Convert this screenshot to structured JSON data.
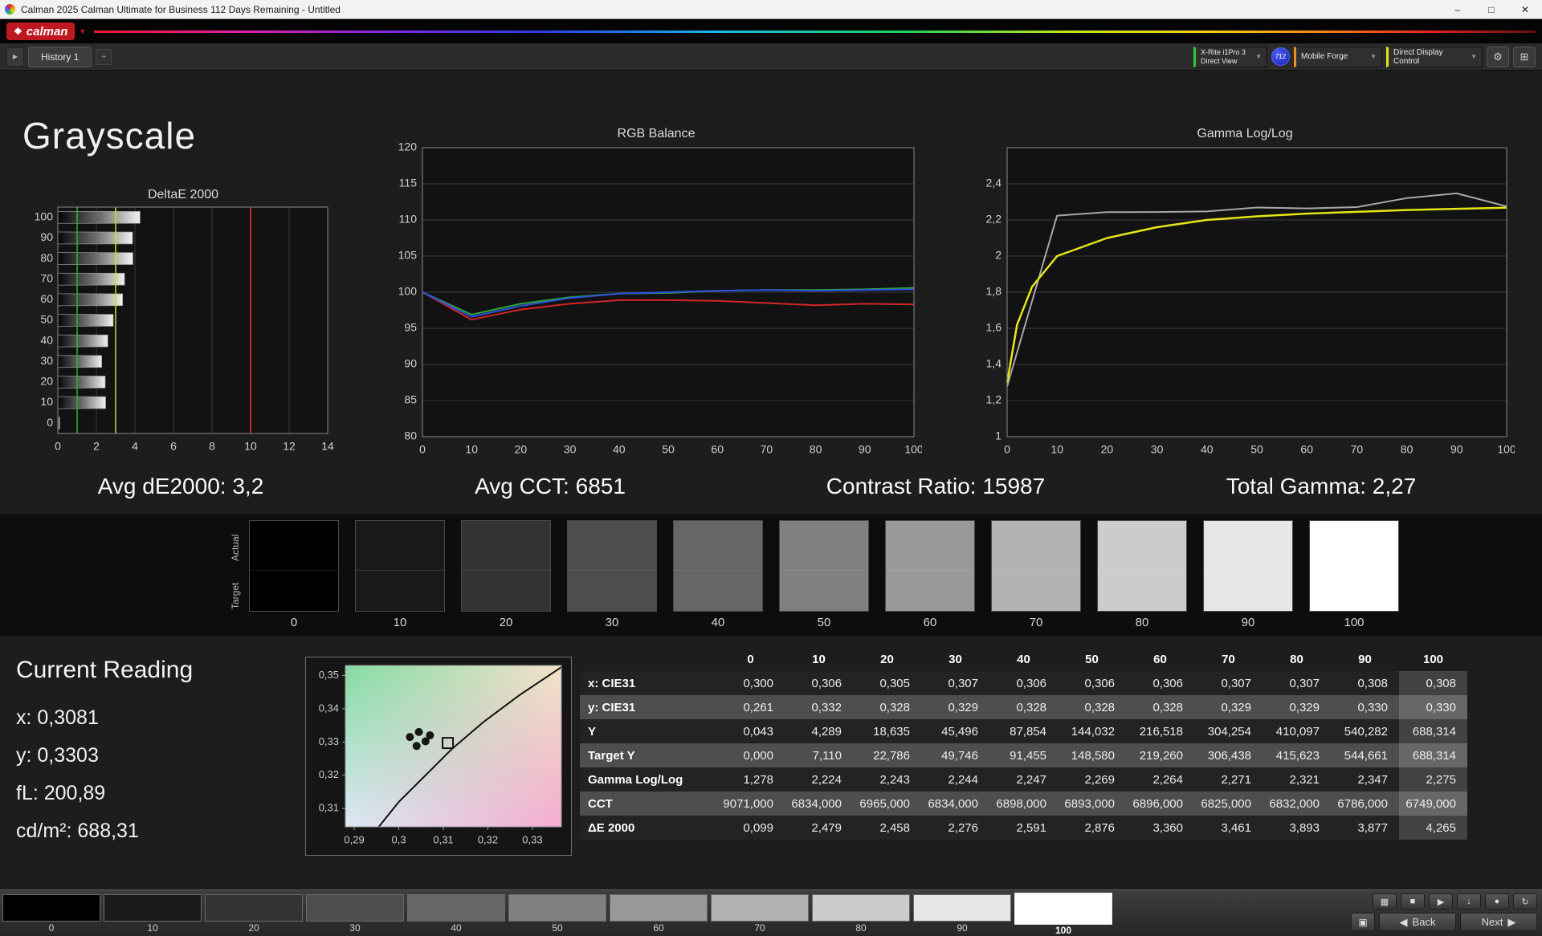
{
  "window": {
    "title": "Calman 2025 Calman Ultimate for Business 112 Days Remaining  - Untitled",
    "minimize_glyph": "–",
    "maximize_glyph": "□",
    "close_glyph": "✕"
  },
  "brand": {
    "logo_text": "calman",
    "logo_mark_glyph": "❖",
    "caret_glyph": "▼"
  },
  "toolbar": {
    "history_toggle_glyph": "▶",
    "history_tab": "History 1",
    "add_glyph": "+",
    "meter_line1": "X-Rite i1Pro 3",
    "meter_line2": "Direct View",
    "meter_badge": "712",
    "source": "Mobile Forge",
    "display_control": "Direct Display Control",
    "caret_glyph": "▼",
    "gear_glyph": "⚙",
    "layout_glyph": "⊞"
  },
  "page": {
    "title": "Grayscale"
  },
  "stats": {
    "avg_de": "Avg dE2000: 3,2",
    "avg_cct": "Avg CCT: 6851",
    "contrast": "Contrast Ratio: 15987",
    "total_gamma": "Total Gamma: 2,27"
  },
  "charts": {
    "deltae": {
      "type": "bar",
      "title": "DeltaE 2000",
      "categories": [
        100,
        90,
        80,
        70,
        60,
        50,
        40,
        30,
        20,
        10,
        0
      ],
      "values": [
        4.265,
        3.877,
        3.893,
        3.461,
        3.36,
        2.876,
        2.591,
        2.276,
        2.458,
        2.479,
        0.099
      ],
      "xlim": [
        0,
        14
      ],
      "xticks": [
        0,
        2,
        4,
        6,
        8,
        10,
        12,
        14
      ],
      "ref_lines": [
        {
          "x": 1,
          "color": "#2db32d"
        },
        {
          "x": 3,
          "color": "#d8d81a"
        },
        {
          "x": 10,
          "color": "#c22222"
        }
      ]
    },
    "rgb_balance": {
      "type": "line",
      "title": "RGB Balance",
      "x": [
        0,
        10,
        20,
        30,
        40,
        50,
        60,
        70,
        80,
        90,
        100
      ],
      "xlim": [
        0,
        100
      ],
      "xticks": [
        0,
        10,
        20,
        30,
        40,
        50,
        60,
        70,
        80,
        90,
        100
      ],
      "ylim": [
        80,
        120
      ],
      "yticks": [
        80,
        85,
        90,
        95,
        100,
        105,
        110,
        115,
        120
      ],
      "ytick_labels": [
        "80",
        "85",
        "90",
        "95",
        "100",
        "105",
        "110",
        "115",
        "120"
      ],
      "series": [
        {
          "name": "Red",
          "color": "#d42525",
          "width": 2,
          "values": [
            100,
            96.2,
            97.6,
            98.4,
            98.9,
            98.9,
            98.8,
            98.5,
            98.2,
            98.4,
            98.3
          ]
        },
        {
          "name": "Green",
          "color": "#2aa83a",
          "width": 2,
          "values": [
            100,
            96.9,
            98.4,
            99.3,
            99.8,
            99.9,
            100.2,
            100.3,
            100.3,
            100.4,
            100.6
          ]
        },
        {
          "name": "Blue",
          "color": "#2f4fe0",
          "width": 2,
          "values": [
            100,
            96.6,
            98.1,
            99.2,
            99.8,
            100,
            100.2,
            100.3,
            100.2,
            100.3,
            100.4
          ]
        }
      ]
    },
    "gamma": {
      "type": "line",
      "title": "Gamma Log/Log",
      "x": [
        0,
        10,
        20,
        30,
        40,
        50,
        60,
        70,
        80,
        90,
        100
      ],
      "xlim": [
        0,
        100
      ],
      "xticks": [
        0,
        10,
        20,
        30,
        40,
        50,
        60,
        70,
        80,
        90,
        100
      ],
      "ylim": [
        1,
        2.6
      ],
      "yticks": [
        1,
        1.2,
        1.4,
        1.6,
        1.8,
        2,
        2.2,
        2.4
      ],
      "ytick_labels": [
        "1",
        "1,2",
        "1,4",
        "1,6",
        "1,8",
        "2",
        "2,2",
        "2,4"
      ],
      "series": [
        {
          "name": "Measured",
          "color": "#a8a8a8",
          "width": 2,
          "values": [
            1.278,
            2.224,
            2.243,
            2.244,
            2.247,
            2.269,
            2.264,
            2.271,
            2.321,
            2.347,
            2.275
          ]
        },
        {
          "name": "Target",
          "color": "#e6e616",
          "width": 2.5,
          "x": [
            0,
            2,
            5,
            10,
            20,
            30,
            40,
            50,
            60,
            70,
            80,
            90,
            100
          ],
          "values": [
            1.3,
            1.62,
            1.83,
            2.0,
            2.1,
            2.16,
            2.2,
            2.22,
            2.235,
            2.245,
            2.255,
            2.262,
            2.268
          ]
        }
      ]
    }
  },
  "swatches": {
    "actual_label": "Actual",
    "target_label": "Target",
    "levels": [
      0,
      10,
      20,
      30,
      40,
      50,
      60,
      70,
      80,
      90,
      100
    ]
  },
  "reading": {
    "title": "Current Reading",
    "items": [
      {
        "label": "x:",
        "value": "0,3081"
      },
      {
        "label": "y:",
        "value": "0,3303"
      },
      {
        "label": "fL:",
        "value": "200,89"
      },
      {
        "label": "cd/m²:",
        "value": "688,31"
      }
    ]
  },
  "cie": {
    "xlim": [
      0.288,
      0.3365
    ],
    "ylim": [
      0.3045,
      0.353
    ],
    "x_ticks": [
      {
        "v": 0.29,
        "label": "0,29"
      },
      {
        "v": 0.3,
        "label": "0,3"
      },
      {
        "v": 0.31,
        "label": "0,31"
      },
      {
        "v": 0.32,
        "label": "0,32"
      },
      {
        "v": 0.33,
        "label": "0,33"
      }
    ],
    "y_ticks": [
      {
        "v": 0.35,
        "label": "0,35"
      },
      {
        "v": 0.34,
        "label": "0,34"
      },
      {
        "v": 0.33,
        "label": "0,33"
      },
      {
        "v": 0.32,
        "label": "0,32"
      },
      {
        "v": 0.31,
        "label": "0,31"
      }
    ],
    "locus": [
      [
        0.2955,
        0.3045
      ],
      [
        0.3,
        0.312
      ],
      [
        0.306,
        0.32
      ],
      [
        0.312,
        0.328
      ],
      [
        0.319,
        0.336
      ],
      [
        0.327,
        0.344
      ],
      [
        0.3365,
        0.3525
      ]
    ],
    "points": [
      [
        0.3025,
        0.3315
      ],
      [
        0.3045,
        0.333
      ],
      [
        0.306,
        0.3302
      ],
      [
        0.304,
        0.3288
      ],
      [
        0.307,
        0.332
      ]
    ],
    "target_marker": [
      0.311,
      0.3297
    ]
  },
  "table": {
    "columns": [
      "0",
      "10",
      "20",
      "30",
      "40",
      "50",
      "60",
      "70",
      "80",
      "90",
      "100"
    ],
    "highlight_column_index": 10,
    "rows": [
      {
        "label": "x: CIE31",
        "values": [
          "0,300",
          "0,306",
          "0,305",
          "0,307",
          "0,306",
          "0,306",
          "0,306",
          "0,307",
          "0,307",
          "0,308",
          "0,308"
        ]
      },
      {
        "label": "y: CIE31",
        "values": [
          "0,261",
          "0,332",
          "0,328",
          "0,329",
          "0,328",
          "0,328",
          "0,328",
          "0,329",
          "0,329",
          "0,330",
          "0,330"
        ]
      },
      {
        "label": "Y",
        "values": [
          "0,043",
          "4,289",
          "18,635",
          "45,496",
          "87,854",
          "144,032",
          "216,518",
          "304,254",
          "410,097",
          "540,282",
          "688,314"
        ]
      },
      {
        "label": "Target Y",
        "values": [
          "0,000",
          "7,110",
          "22,786",
          "49,746",
          "91,455",
          "148,580",
          "219,260",
          "306,438",
          "415,623",
          "544,661",
          "688,314"
        ]
      },
      {
        "label": "Gamma Log/Log",
        "values": [
          "1,278",
          "2,224",
          "2,243",
          "2,244",
          "2,247",
          "2,269",
          "2,264",
          "2,271",
          "2,321",
          "2,347",
          "2,275"
        ]
      },
      {
        "label": "CCT",
        "values": [
          "9071,000",
          "6834,000",
          "6965,000",
          "6834,000",
          "6898,000",
          "6893,000",
          "6896,000",
          "6825,000",
          "6832,000",
          "6786,000",
          "6749,000"
        ]
      },
      {
        "label": "ΔE 2000",
        "values": [
          "0,099",
          "2,479",
          "2,458",
          "2,276",
          "2,591",
          "2,876",
          "3,360",
          "3,461",
          "3,893",
          "3,877",
          "4,265"
        ]
      }
    ]
  },
  "bottom": {
    "levels": [
      0,
      10,
      20,
      30,
      40,
      50,
      60,
      70,
      80,
      90,
      100
    ],
    "selected": 100,
    "back_label": "Back",
    "next_label": "Next",
    "back_icon": "◀",
    "next_icon": "▶",
    "grid_button_glyph": "▣",
    "transport_buttons": [
      {
        "name": "pattern-window-button",
        "glyph": "▦"
      },
      {
        "name": "stop-button",
        "glyph": "■"
      },
      {
        "name": "play-button",
        "glyph": "▶"
      },
      {
        "name": "save-button",
        "glyph": "↓"
      },
      {
        "name": "record-button",
        "glyph": "●"
      },
      {
        "name": "refresh-button",
        "glyph": "↻"
      }
    ]
  }
}
